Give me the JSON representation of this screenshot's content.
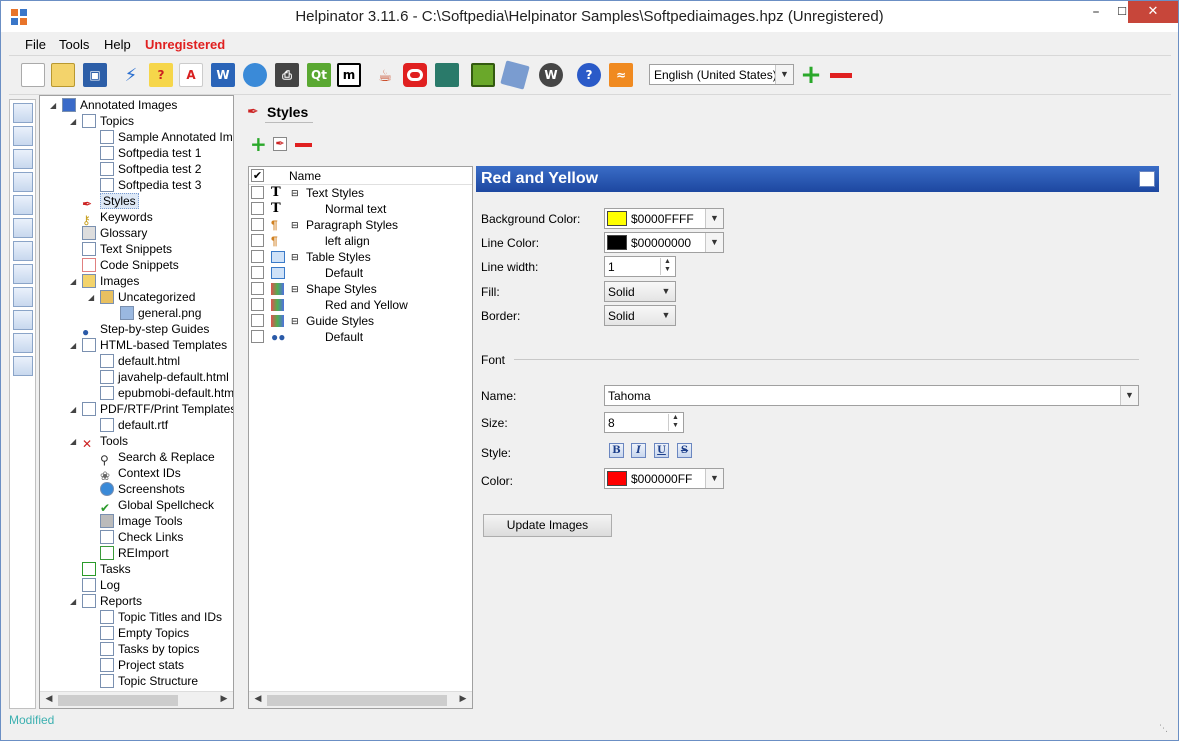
{
  "window": {
    "title": "Helpinator 3.11.6 - C:\\Softpedia\\Helpinator Samples\\Softpediaimages.hpz (Unregistered)"
  },
  "menu": {
    "file": "File",
    "tools": "Tools",
    "help": "Help",
    "unregistered": "Unregistered"
  },
  "toolbar": {
    "language": "English (United States)",
    "icons": [
      "new-document",
      "open-document",
      "save",
      "compile",
      "help-wizard",
      "pdf",
      "word",
      "web",
      "print",
      "qt",
      "markdown",
      "java",
      "opera",
      "book",
      "epub",
      "mobile",
      "wordpress",
      "help",
      "rss"
    ]
  },
  "tree": [
    {
      "label": "Annotated Images",
      "level": 0
    },
    {
      "label": "Topics",
      "level": 1
    },
    {
      "label": "Sample Annotated Image",
      "level": 2
    },
    {
      "label": "Softpedia test 1",
      "level": 2
    },
    {
      "label": "Softpedia test 2",
      "level": 2
    },
    {
      "label": "Softpedia test 3",
      "level": 2
    },
    {
      "label": "Styles",
      "level": 1,
      "selected": true
    },
    {
      "label": "Keywords",
      "level": 1
    },
    {
      "label": "Glossary",
      "level": 1
    },
    {
      "label": "Text Snippets",
      "level": 1
    },
    {
      "label": "Code Snippets",
      "level": 1
    },
    {
      "label": "Images",
      "level": 1
    },
    {
      "label": "Uncategorized",
      "level": 2
    },
    {
      "label": "general.png",
      "level": 3
    },
    {
      "label": "Step-by-step Guides",
      "level": 1
    },
    {
      "label": "HTML-based Templates",
      "level": 1
    },
    {
      "label": "default.html",
      "level": 2
    },
    {
      "label": "javahelp-default.html",
      "level": 2
    },
    {
      "label": "epubmobi-default.html",
      "level": 2
    },
    {
      "label": "PDF/RTF/Print Templates",
      "level": 1
    },
    {
      "label": "default.rtf",
      "level": 2
    },
    {
      "label": "Tools",
      "level": 1
    },
    {
      "label": "Search & Replace",
      "level": 2
    },
    {
      "label": "Context IDs",
      "level": 2
    },
    {
      "label": "Screenshots",
      "level": 2
    },
    {
      "label": "Global Spellcheck",
      "level": 2
    },
    {
      "label": "Image Tools",
      "level": 2
    },
    {
      "label": "Check Links",
      "level": 2
    },
    {
      "label": "REImport",
      "level": 2
    },
    {
      "label": "Tasks",
      "level": 1
    },
    {
      "label": "Log",
      "level": 1
    },
    {
      "label": "Reports",
      "level": 1
    },
    {
      "label": "Topic Titles and IDs",
      "level": 2
    },
    {
      "label": "Empty Topics",
      "level": 2
    },
    {
      "label": "Tasks by topics",
      "level": 2
    },
    {
      "label": "Project stats",
      "level": 2
    },
    {
      "label": "Topic Structure",
      "level": 2
    }
  ],
  "styles_panel": {
    "title": "Styles",
    "column_name": "Name",
    "rows": [
      {
        "label": "Text Styles",
        "group": true
      },
      {
        "label": "Normal text",
        "group": false
      },
      {
        "label": "Paragraph Styles",
        "group": true
      },
      {
        "label": "left align",
        "group": false
      },
      {
        "label": "Table Styles",
        "group": true
      },
      {
        "label": "Default",
        "group": false
      },
      {
        "label": "Shape Styles",
        "group": true
      },
      {
        "label": "Red and Yellow",
        "group": false
      },
      {
        "label": "Guide Styles",
        "group": true
      },
      {
        "label": "Default",
        "group": false
      }
    ]
  },
  "detail": {
    "header": "Red and Yellow",
    "background_color": {
      "label": "Background Color:",
      "value": "$0000FFFF",
      "swatch": "#ffff00"
    },
    "line_color": {
      "label": "Line Color:",
      "value": "$00000000",
      "swatch": "#000000"
    },
    "line_width": {
      "label": "Line width:",
      "value": "1"
    },
    "fill": {
      "label": "Fill:",
      "value": "Solid"
    },
    "border": {
      "label": "Border:",
      "value": "Solid"
    },
    "font_section": "Font",
    "font_name": {
      "label": "Name:",
      "value": "Tahoma"
    },
    "font_size": {
      "label": "Size:",
      "value": "8"
    },
    "font_style": {
      "label": "Style:",
      "buttons": [
        "B",
        "I",
        "U",
        "S"
      ]
    },
    "font_color": {
      "label": "Color:",
      "value": "$000000FF",
      "swatch": "#ff0000"
    },
    "update_button": "Update Images"
  },
  "status": {
    "text": "Modified"
  }
}
